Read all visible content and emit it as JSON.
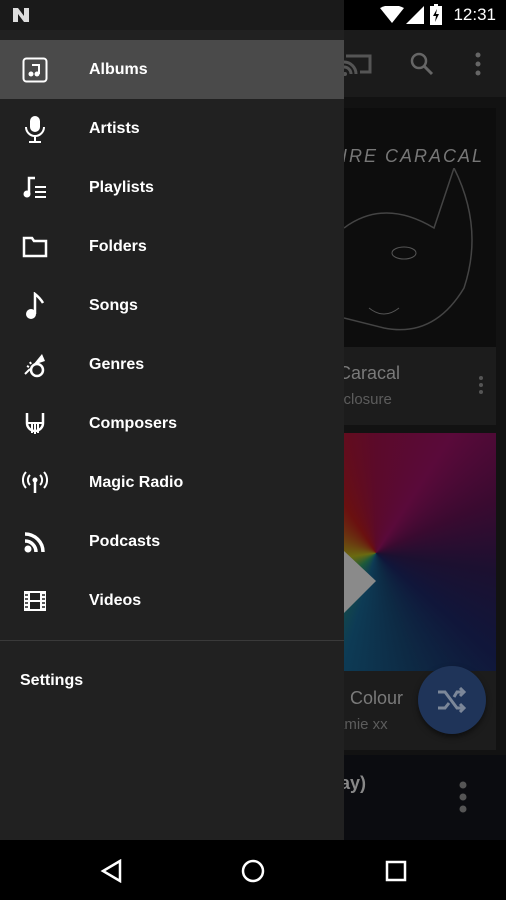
{
  "status_bar": {
    "time": "12:31",
    "icons": [
      "n-logo-icon",
      "wifi-icon",
      "cell-signal-icon",
      "battery-charging-icon"
    ]
  },
  "toolbar": {
    "icons": [
      "cast-icon",
      "search-icon",
      "more-vert-icon"
    ]
  },
  "albums": [
    {
      "title": "Caracal",
      "artist": "sclosure",
      "cover_text": "IRE CARACAL"
    },
    {
      "title": "Colour",
      "artist": "amie xx"
    }
  ],
  "now_playing": {
    "title": "ay)"
  },
  "drawer": {
    "items": [
      {
        "label": "Albums",
        "icon": "album-icon",
        "selected": true
      },
      {
        "label": "Artists",
        "icon": "microphone-icon"
      },
      {
        "label": "Playlists",
        "icon": "playlist-icon"
      },
      {
        "label": "Folders",
        "icon": "folder-icon"
      },
      {
        "label": "Songs",
        "icon": "music-note-icon"
      },
      {
        "label": "Genres",
        "icon": "trumpet-icon"
      },
      {
        "label": "Composers",
        "icon": "lyre-icon"
      },
      {
        "label": "Magic Radio",
        "icon": "radio-tower-icon"
      },
      {
        "label": "Podcasts",
        "icon": "rss-icon"
      },
      {
        "label": "Videos",
        "icon": "film-icon"
      }
    ],
    "settings_label": "Settings"
  },
  "fab": {
    "icon": "shuffle-icon"
  },
  "colors": {
    "drawer": "#212121",
    "selected": "#4a4a4a",
    "fab": "#1f3459"
  }
}
